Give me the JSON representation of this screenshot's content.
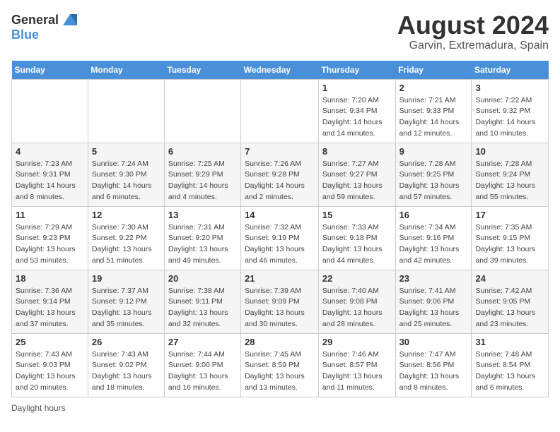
{
  "header": {
    "logo_general": "General",
    "logo_blue": "Blue",
    "month_title": "August 2024",
    "location": "Garvin, Extremadura, Spain"
  },
  "days_of_week": [
    "Sunday",
    "Monday",
    "Tuesday",
    "Wednesday",
    "Thursday",
    "Friday",
    "Saturday"
  ],
  "weeks": [
    [
      {
        "day": "",
        "sunrise": "",
        "sunset": "",
        "daylight": ""
      },
      {
        "day": "",
        "sunrise": "",
        "sunset": "",
        "daylight": ""
      },
      {
        "day": "",
        "sunrise": "",
        "sunset": "",
        "daylight": ""
      },
      {
        "day": "",
        "sunrise": "",
        "sunset": "",
        "daylight": ""
      },
      {
        "day": "1",
        "sunrise": "Sunrise: 7:20 AM",
        "sunset": "Sunset: 9:34 PM",
        "daylight": "Daylight: 14 hours and 14 minutes."
      },
      {
        "day": "2",
        "sunrise": "Sunrise: 7:21 AM",
        "sunset": "Sunset: 9:33 PM",
        "daylight": "Daylight: 14 hours and 12 minutes."
      },
      {
        "day": "3",
        "sunrise": "Sunrise: 7:22 AM",
        "sunset": "Sunset: 9:32 PM",
        "daylight": "Daylight: 14 hours and 10 minutes."
      }
    ],
    [
      {
        "day": "4",
        "sunrise": "Sunrise: 7:23 AM",
        "sunset": "Sunset: 9:31 PM",
        "daylight": "Daylight: 14 hours and 8 minutes."
      },
      {
        "day": "5",
        "sunrise": "Sunrise: 7:24 AM",
        "sunset": "Sunset: 9:30 PM",
        "daylight": "Daylight: 14 hours and 6 minutes."
      },
      {
        "day": "6",
        "sunrise": "Sunrise: 7:25 AM",
        "sunset": "Sunset: 9:29 PM",
        "daylight": "Daylight: 14 hours and 4 minutes."
      },
      {
        "day": "7",
        "sunrise": "Sunrise: 7:26 AM",
        "sunset": "Sunset: 9:28 PM",
        "daylight": "Daylight: 14 hours and 2 minutes."
      },
      {
        "day": "8",
        "sunrise": "Sunrise: 7:27 AM",
        "sunset": "Sunset: 9:27 PM",
        "daylight": "Daylight: 13 hours and 59 minutes."
      },
      {
        "day": "9",
        "sunrise": "Sunrise: 7:28 AM",
        "sunset": "Sunset: 9:25 PM",
        "daylight": "Daylight: 13 hours and 57 minutes."
      },
      {
        "day": "10",
        "sunrise": "Sunrise: 7:28 AM",
        "sunset": "Sunset: 9:24 PM",
        "daylight": "Daylight: 13 hours and 55 minutes."
      }
    ],
    [
      {
        "day": "11",
        "sunrise": "Sunrise: 7:29 AM",
        "sunset": "Sunset: 9:23 PM",
        "daylight": "Daylight: 13 hours and 53 minutes."
      },
      {
        "day": "12",
        "sunrise": "Sunrise: 7:30 AM",
        "sunset": "Sunset: 9:22 PM",
        "daylight": "Daylight: 13 hours and 51 minutes."
      },
      {
        "day": "13",
        "sunrise": "Sunrise: 7:31 AM",
        "sunset": "Sunset: 9:20 PM",
        "daylight": "Daylight: 13 hours and 49 minutes."
      },
      {
        "day": "14",
        "sunrise": "Sunrise: 7:32 AM",
        "sunset": "Sunset: 9:19 PM",
        "daylight": "Daylight: 13 hours and 46 minutes."
      },
      {
        "day": "15",
        "sunrise": "Sunrise: 7:33 AM",
        "sunset": "Sunset: 9:18 PM",
        "daylight": "Daylight: 13 hours and 44 minutes."
      },
      {
        "day": "16",
        "sunrise": "Sunrise: 7:34 AM",
        "sunset": "Sunset: 9:16 PM",
        "daylight": "Daylight: 13 hours and 42 minutes."
      },
      {
        "day": "17",
        "sunrise": "Sunrise: 7:35 AM",
        "sunset": "Sunset: 9:15 PM",
        "daylight": "Daylight: 13 hours and 39 minutes."
      }
    ],
    [
      {
        "day": "18",
        "sunrise": "Sunrise: 7:36 AM",
        "sunset": "Sunset: 9:14 PM",
        "daylight": "Daylight: 13 hours and 37 minutes."
      },
      {
        "day": "19",
        "sunrise": "Sunrise: 7:37 AM",
        "sunset": "Sunset: 9:12 PM",
        "daylight": "Daylight: 13 hours and 35 minutes."
      },
      {
        "day": "20",
        "sunrise": "Sunrise: 7:38 AM",
        "sunset": "Sunset: 9:11 PM",
        "daylight": "Daylight: 13 hours and 32 minutes."
      },
      {
        "day": "21",
        "sunrise": "Sunrise: 7:39 AM",
        "sunset": "Sunset: 9:09 PM",
        "daylight": "Daylight: 13 hours and 30 minutes."
      },
      {
        "day": "22",
        "sunrise": "Sunrise: 7:40 AM",
        "sunset": "Sunset: 9:08 PM",
        "daylight": "Daylight: 13 hours and 28 minutes."
      },
      {
        "day": "23",
        "sunrise": "Sunrise: 7:41 AM",
        "sunset": "Sunset: 9:06 PM",
        "daylight": "Daylight: 13 hours and 25 minutes."
      },
      {
        "day": "24",
        "sunrise": "Sunrise: 7:42 AM",
        "sunset": "Sunset: 9:05 PM",
        "daylight": "Daylight: 13 hours and 23 minutes."
      }
    ],
    [
      {
        "day": "25",
        "sunrise": "Sunrise: 7:43 AM",
        "sunset": "Sunset: 9:03 PM",
        "daylight": "Daylight: 13 hours and 20 minutes."
      },
      {
        "day": "26",
        "sunrise": "Sunrise: 7:43 AM",
        "sunset": "Sunset: 9:02 PM",
        "daylight": "Daylight: 13 hours and 18 minutes."
      },
      {
        "day": "27",
        "sunrise": "Sunrise: 7:44 AM",
        "sunset": "Sunset: 9:00 PM",
        "daylight": "Daylight: 13 hours and 16 minutes."
      },
      {
        "day": "28",
        "sunrise": "Sunrise: 7:45 AM",
        "sunset": "Sunset: 8:59 PM",
        "daylight": "Daylight: 13 hours and 13 minutes."
      },
      {
        "day": "29",
        "sunrise": "Sunrise: 7:46 AM",
        "sunset": "Sunset: 8:57 PM",
        "daylight": "Daylight: 13 hours and 11 minutes."
      },
      {
        "day": "30",
        "sunrise": "Sunrise: 7:47 AM",
        "sunset": "Sunset: 8:56 PM",
        "daylight": "Daylight: 13 hours and 8 minutes."
      },
      {
        "day": "31",
        "sunrise": "Sunrise: 7:48 AM",
        "sunset": "Sunset: 8:54 PM",
        "daylight": "Daylight: 13 hours and 6 minutes."
      }
    ]
  ],
  "footer": {
    "note": "Daylight hours"
  }
}
